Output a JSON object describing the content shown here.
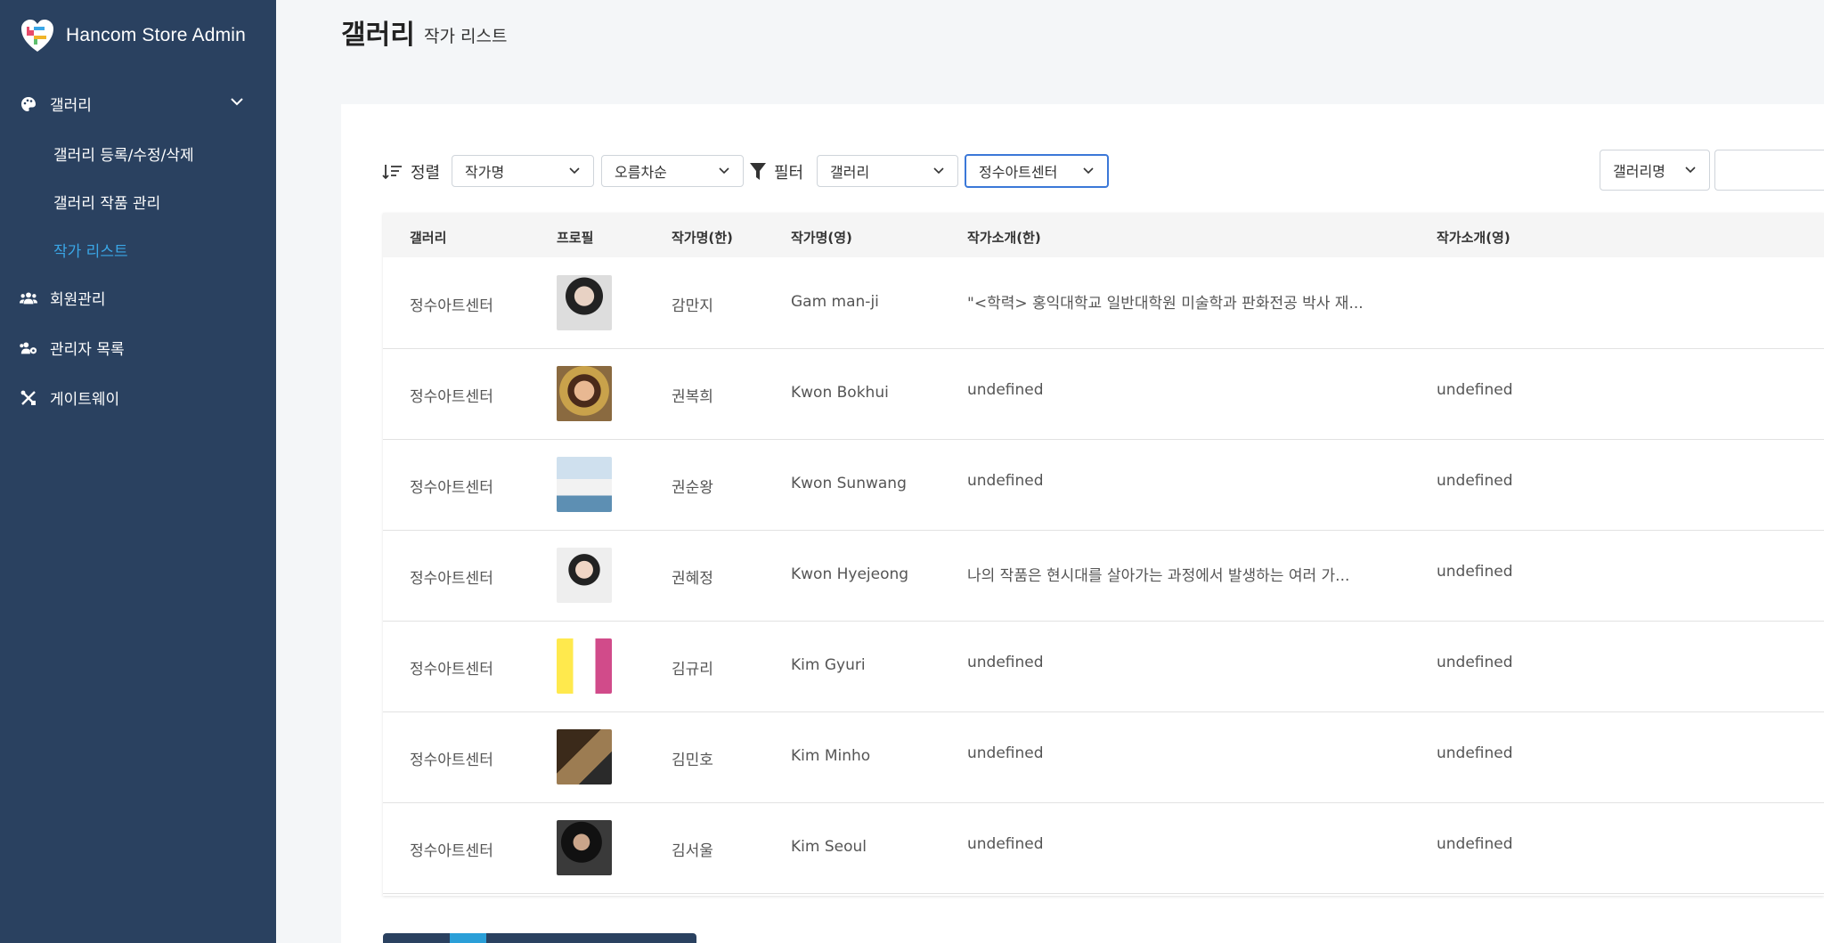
{
  "app": {
    "name": "Hancom Store Admin"
  },
  "sidebar": {
    "gallery": "갤러리",
    "sub_items": [
      "갤러리 등록/수정/삭제",
      "갤러리 작품 관리",
      "작가 리스트"
    ],
    "members": "회원관리",
    "admins": "관리자 목록",
    "gateway": "게이트웨이"
  },
  "page": {
    "title": "갤러리",
    "subtitle": "작가 리스트"
  },
  "toolbar": {
    "sort_label": "정렬",
    "sort_field": "작가명",
    "sort_order": "오름차순",
    "filter_label": "필터",
    "filter_field": "갤러리",
    "filter_value": "정수아트센터",
    "search_field": "갤러리명"
  },
  "table": {
    "headers": [
      "갤러리",
      "프로필",
      "작가명(한)",
      "작가명(영)",
      "작가소개(한)",
      "작가소개(영)"
    ],
    "rows": [
      {
        "gallery": "정수아트센터",
        "name_ko": "감만지",
        "name_en": "Gam man-ji",
        "intro_ko": "\"<학력> 홍익대학교 일반대학원 미술학과 판화전공 박사 재...",
        "intro_en": ""
      },
      {
        "gallery": "정수아트센터",
        "name_ko": "권복희",
        "name_en": "Kwon Bokhui",
        "intro_ko": "undefined",
        "intro_en": "undefined"
      },
      {
        "gallery": "정수아트센터",
        "name_ko": "권순왕",
        "name_en": "Kwon Sunwang",
        "intro_ko": "undefined",
        "intro_en": "undefined"
      },
      {
        "gallery": "정수아트센터",
        "name_ko": "권혜정",
        "name_en": "Kwon Hyejeong",
        "intro_ko": "나의 작품은 현시대를 살아가는 과정에서 발생하는 여러 가...",
        "intro_en": "undefined"
      },
      {
        "gallery": "정수아트센터",
        "name_ko": "김규리",
        "name_en": "Kim Gyuri",
        "intro_ko": "undefined",
        "intro_en": "undefined"
      },
      {
        "gallery": "정수아트센터",
        "name_ko": "김민호",
        "name_en": "Kim Minho",
        "intro_ko": "undefined",
        "intro_en": "undefined"
      },
      {
        "gallery": "정수아트센터",
        "name_ko": "김서울",
        "name_en": "Kim Seoul",
        "intro_ko": "undefined",
        "intro_en": "undefined"
      }
    ]
  },
  "colors": {
    "sidebar": "#2a4160",
    "accent": "#3aa6e6",
    "focus": "#3b78d8"
  }
}
